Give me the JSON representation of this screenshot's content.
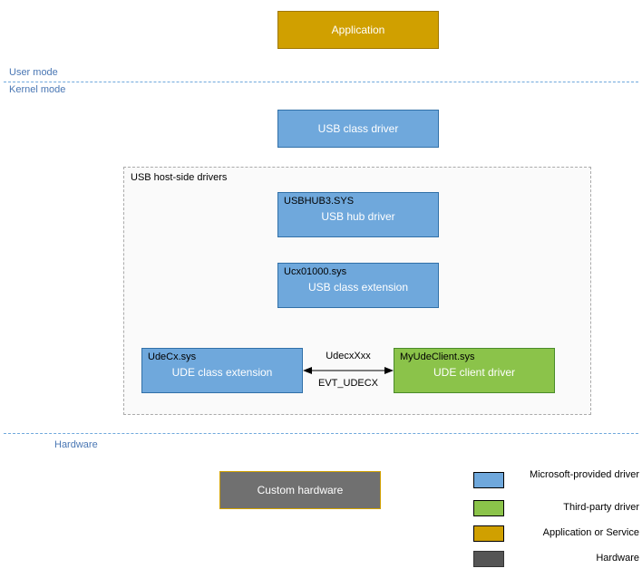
{
  "app": {
    "label": "Application"
  },
  "modes": {
    "user": "User mode",
    "kernel": "Kernel mode",
    "hardware": "Hardware"
  },
  "usb_class_driver": {
    "label": "USB class driver"
  },
  "group": {
    "title": "USB host-side drivers"
  },
  "usbhub3": {
    "title": "USBHUB3.SYS",
    "label": "USB hub driver"
  },
  "ucx": {
    "title": "Ucx01000.sys",
    "label": "USB class extension"
  },
  "udecx": {
    "title": "UdeCx.sys",
    "label": "UDE class extension"
  },
  "client": {
    "title": "MyUdeClient.sys",
    "label": "UDE client driver"
  },
  "arrows": {
    "top": "UdecxXxx",
    "bottom": "EVT_UDECX"
  },
  "hardware": {
    "label": "Custom hardware"
  },
  "legend": {
    "ms": "Microsoft-provided driver",
    "tp": "Third-party driver",
    "app": "Application or Service",
    "hw": "Hardware"
  }
}
